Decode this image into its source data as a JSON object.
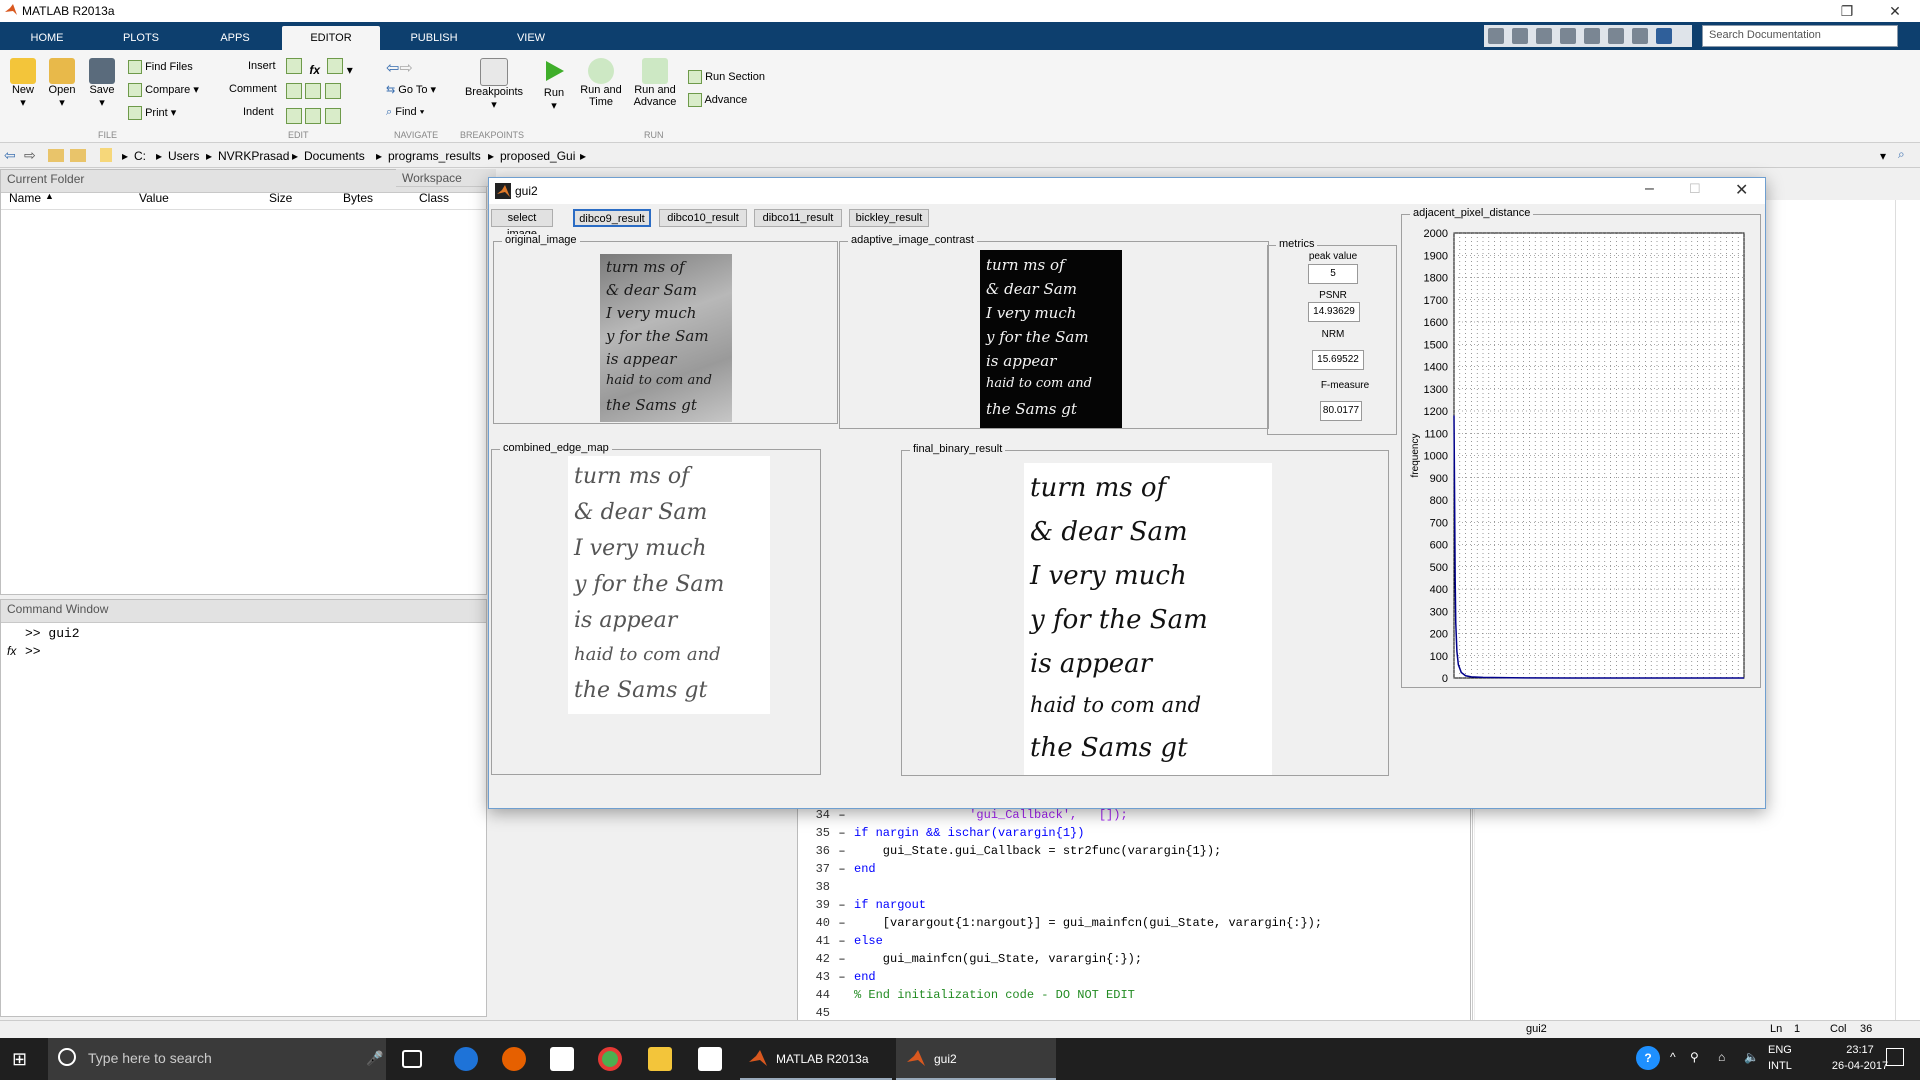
{
  "app": {
    "title": "MATLAB R2013a"
  },
  "ribbon": {
    "tabs": [
      "HOME",
      "PLOTS",
      "APPS",
      "EDITOR",
      "PUBLISH",
      "VIEW"
    ],
    "active_tab": "EDITOR",
    "search_placeholder": "Search Documentation",
    "file": {
      "new": "New",
      "open": "Open",
      "save": "Save",
      "find_files": "Find Files",
      "compare": "Compare",
      "print": "Print",
      "section": "FILE"
    },
    "edit": {
      "insert": "Insert",
      "comment": "Comment",
      "indent": "Indent",
      "section": "EDIT"
    },
    "navigate": {
      "go_to": "Go To",
      "find": "Find",
      "section": "NAVIGATE"
    },
    "breakpoints": {
      "label": "Breakpoints",
      "section": "BREAKPOINTS"
    },
    "run": {
      "run": "Run",
      "run_and_time_1": "Run and",
      "run_and_time_2": "Time",
      "run_and_advance_1": "Run and",
      "run_and_advance_2": "Advance",
      "run_section": "Run Section",
      "advance": "Advance",
      "section": "RUN"
    }
  },
  "address": {
    "path": [
      "C:",
      "Users",
      "NVRKPrasad",
      "Documents",
      "programs_results",
      "proposed_Gui"
    ]
  },
  "current_folder": {
    "title": "Current Folder"
  },
  "workspace": {
    "title": "Workspace",
    "columns": [
      "Name",
      "Value",
      "Size",
      "Bytes",
      "Class"
    ]
  },
  "command_window": {
    "title": "Command Window",
    "lines": [
      ">> gui2",
      ">>"
    ],
    "fx": "fx"
  },
  "editor": {
    "lines": [
      {
        "n": "34",
        "d": "–",
        "code": "                'gui_Callback',   []);",
        "type": "mixed"
      },
      {
        "n": "35",
        "d": "–",
        "code": "if nargin && ischar(varargin{1})",
        "type": "kw"
      },
      {
        "n": "36",
        "d": "–",
        "code": "    gui_State.gui_Callback = str2func(varargin{1});",
        "type": "plain"
      },
      {
        "n": "37",
        "d": "–",
        "code": "end",
        "type": "kw"
      },
      {
        "n": "38",
        "d": "",
        "code": "",
        "type": "plain"
      },
      {
        "n": "39",
        "d": "–",
        "code": "if nargout",
        "type": "kw"
      },
      {
        "n": "40",
        "d": "–",
        "code": "    [varargout{1:nargout}] = gui_mainfcn(gui_State, varargin{:});",
        "type": "plain"
      },
      {
        "n": "41",
        "d": "–",
        "code": "else",
        "type": "kw"
      },
      {
        "n": "42",
        "d": "–",
        "code": "    gui_mainfcn(gui_State, varargin{:});",
        "type": "plain"
      },
      {
        "n": "43",
        "d": "–",
        "code": "end",
        "type": "kw"
      },
      {
        "n": "44",
        "d": "",
        "code": "% End initialization code - DO NOT EDIT",
        "type": "cm"
      },
      {
        "n": "45",
        "d": "",
        "code": "",
        "type": "plain"
      }
    ]
  },
  "status": {
    "file": "gui2",
    "ln_label": "Ln",
    "ln": "1",
    "col_label": "Col",
    "col": "36"
  },
  "taskbar": {
    "search": "Type here to search",
    "app1": "MATLAB R2013a",
    "app2": "gui2",
    "lang1": "ENG",
    "lang2": "INTL",
    "time": "23:17",
    "date": "26-04-2017"
  },
  "gui2": {
    "title": "gui2",
    "buttons": [
      "select image",
      "dibco9_result",
      "dibco10_result",
      "dibco11_result",
      "bickley_result"
    ],
    "panels": {
      "original": "original_image",
      "contrast": "adaptive_image_contrast",
      "metrics": "metrics",
      "edge": "combined_edge_map",
      "binary": "final_binary_result",
      "histogram": "adjacent_pixel_distance"
    },
    "metrics": [
      {
        "label": "peak value",
        "value": "5"
      },
      {
        "label": "PSNR",
        "value": "14.93629"
      },
      {
        "label": "NRM",
        "value": "15.69522"
      },
      {
        "label": "F-measure",
        "value": "80.0177"
      }
    ],
    "handwriting": [
      "turn ms of",
      "& dear Sam",
      "I very much",
      "y for the Sam",
      "is appear",
      "haid to com and",
      "the Sams gt"
    ]
  },
  "chart_data": {
    "type": "line",
    "title": "adjacent_pixel_distance",
    "ylabel": "frequency",
    "ylim": [
      0,
      2000
    ],
    "y_ticks": [
      0,
      100,
      200,
      300,
      400,
      500,
      600,
      700,
      800,
      900,
      1000,
      1100,
      1200,
      1300,
      1400,
      1500,
      1600,
      1700,
      1800,
      1900,
      2000
    ],
    "xlim": [
      0,
      1000
    ],
    "grid": true,
    "series": [
      {
        "x": [
          0,
          2,
          4,
          6,
          10,
          15,
          25,
          40,
          60,
          100,
          200,
          400,
          700,
          1000
        ],
        "values": [
          1180,
          820,
          450,
          250,
          120,
          60,
          25,
          10,
          5,
          3,
          1,
          0,
          0,
          0
        ],
        "color": "#00008b"
      }
    ]
  }
}
